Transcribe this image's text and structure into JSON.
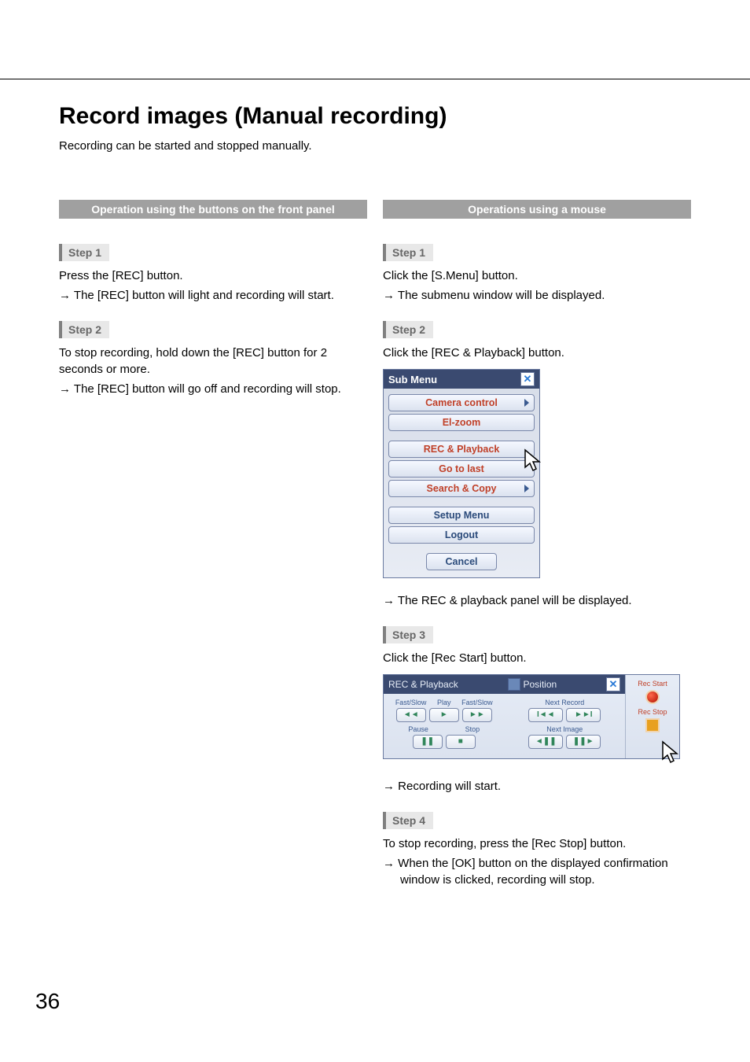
{
  "page_number": "36",
  "title": "Record images (Manual recording)",
  "intro": "Recording can be started and stopped manually.",
  "left": {
    "section_title": "Operation using the buttons on the front panel",
    "step1_label": "Step 1",
    "step1_text": "Press the [REC] button.",
    "step1_arrow": "The [REC] button will light and recording will start.",
    "step2_label": "Step 2",
    "step2_text": "To stop recording, hold down the [REC] button for 2 seconds or more.",
    "step2_arrow": "The [REC] button will go off and recording will stop."
  },
  "right": {
    "section_title": "Operations using a mouse",
    "step1_label": "Step 1",
    "step1_text": "Click the [S.Menu] button.",
    "step1_arrow": "The submenu window will be displayed.",
    "step2_label": "Step 2",
    "step2_text": "Click the [REC & Playback] button.",
    "step2_arrow": "The REC & playback panel will be displayed.",
    "step3_label": "Step 3",
    "step3_text": "Click the [Rec Start] button.",
    "step3_arrow": "Recording will start.",
    "step4_label": "Step 4",
    "step4_text": "To stop recording, press the [Rec Stop] button.",
    "step4_arrow": "When the [OK] button on the displayed confirmation window is clicked, recording will stop."
  },
  "submenu": {
    "title": "Sub Menu",
    "items": {
      "camera_control": "Camera control",
      "el_zoom": "El-zoom",
      "rec_playback": "REC & Playback",
      "go_to_last": "Go to last",
      "search_copy": "Search & Copy",
      "setup_menu": "Setup Menu",
      "logout": "Logout",
      "cancel": "Cancel"
    }
  },
  "rp_panel": {
    "title": "REC & Playback",
    "position": "Position",
    "labels": {
      "fast_slow_l": "Fast/Slow",
      "play": "Play",
      "fast_slow_r": "Fast/Slow",
      "pause": "Pause",
      "stop": "Stop",
      "next_record": "Next Record",
      "next_image": "Next Image",
      "rec_start": "Rec Start",
      "rec_stop": "Rec Stop"
    },
    "glyphs": {
      "rew": "◄◄",
      "play": "►",
      "ff": "►►",
      "pause": "❚❚",
      "stop": "■",
      "skip_prev": "I◄◄",
      "skip_next": "►►I",
      "frame_prev": "◄❚❚",
      "frame_next": "❚❚►"
    }
  }
}
